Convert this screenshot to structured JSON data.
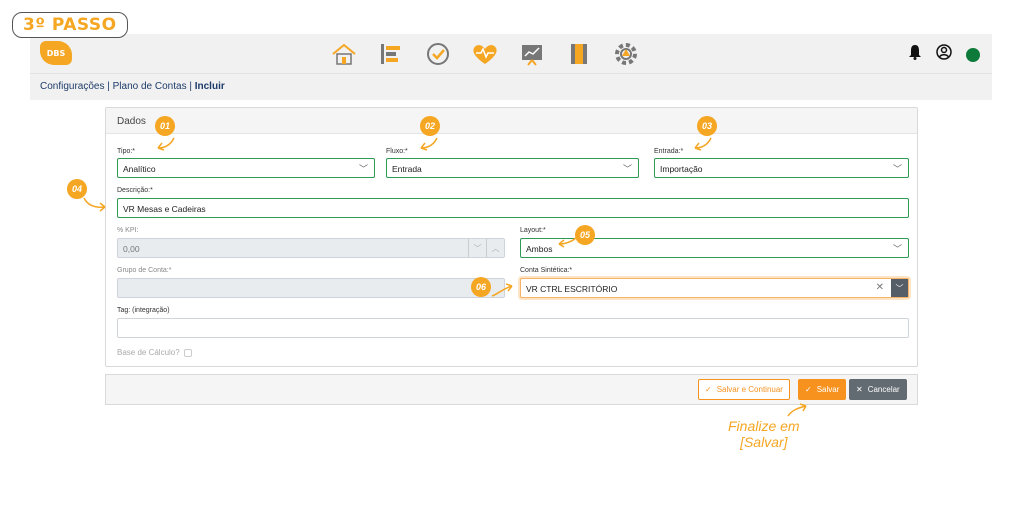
{
  "step": {
    "label": "3º PASSO"
  },
  "app": {
    "logo_text": "DBS",
    "nav_icons": [
      "home-icon",
      "list-icon",
      "check-circle-icon",
      "heart-pulse-icon",
      "chart-icon",
      "notebook-icon",
      "gear-icon"
    ],
    "right_icons": [
      "bell-icon",
      "user-icon",
      "status-dot"
    ]
  },
  "breadcrumb": {
    "part1": "Configurações | Plano de Contas | ",
    "current": "Incluir"
  },
  "form": {
    "section_title": "Dados",
    "tipo": {
      "label": "Tipo:*",
      "value": "Analítico"
    },
    "fluxo": {
      "label": "Fluxo:*",
      "value": "Entrada"
    },
    "entrada": {
      "label": "Entrada:*",
      "value": "Importação"
    },
    "descricao": {
      "label": "Descrição:*",
      "value": "VR Mesas e Cadeiras"
    },
    "kpi": {
      "label": "% KPI:",
      "value": "0,00"
    },
    "layout": {
      "label": "Layout:*",
      "value": "Ambos"
    },
    "grupo": {
      "label": "Grupo de Conta:*",
      "value": ""
    },
    "conta_sintetica": {
      "label": "Conta Sintética:*",
      "value": "VR CTRL ESCRITÓRIO"
    },
    "tag": {
      "label": "Tag: (integração)",
      "value": ""
    },
    "base_calculo": {
      "label": "Base de Cálculo?"
    }
  },
  "actions": {
    "save_continue": "Salvar e Continuar",
    "save": "Salvar",
    "cancel": "Cancelar"
  },
  "annotations": {
    "n1": "01",
    "n2": "02",
    "n3": "03",
    "n4": "04",
    "n5": "05",
    "n6": "06",
    "finalize_line1": "Finalize em",
    "finalize_line2": "[Salvar]"
  },
  "colors": {
    "accent": "#f5a623",
    "button_orange": "#f7921e",
    "field_border": "#2e9a54",
    "status": "#0d7a3a"
  }
}
